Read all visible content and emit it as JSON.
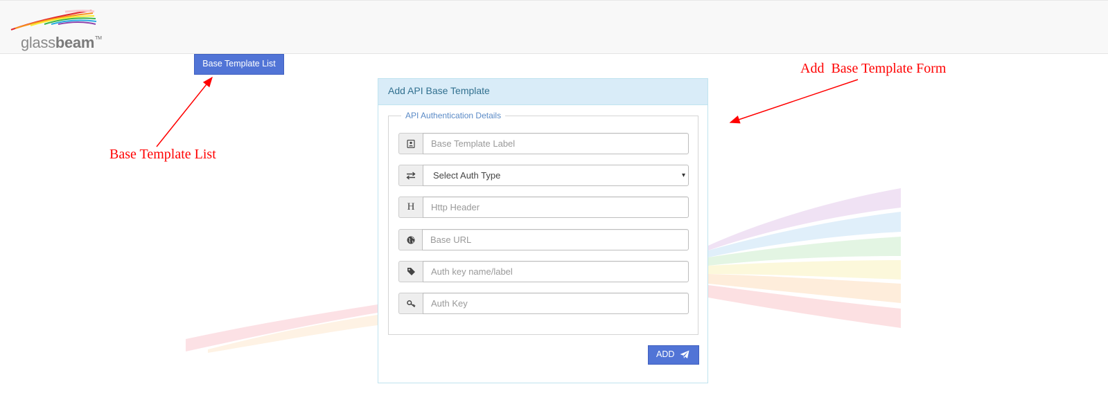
{
  "brand": {
    "logo_regular": "glass",
    "logo_bold": "beam",
    "logo_tm": "TM"
  },
  "nav": {
    "base_template_list_button": "Base Template List"
  },
  "annotations": {
    "list_note": "Base Template List",
    "form_note": "Add  Base Template Form"
  },
  "panel": {
    "title": "Add API Base Template",
    "fieldset_legend": "API Authentication Details",
    "fields": {
      "label_placeholder": "Base Template Label",
      "auth_type_selected": "Select Auth Type",
      "http_header_placeholder": "Http Header",
      "base_url_placeholder": "Base URL",
      "auth_key_name_placeholder": "Auth key name/label",
      "auth_key_placeholder": "Auth Key"
    },
    "icons": {
      "label": "address-card-icon",
      "auth_type": "exchange-arrows-icon",
      "http_header": "header-h-icon",
      "base_url": "globe-icon",
      "auth_key_name": "tag-icon",
      "auth_key": "key-icon",
      "submit": "paper-plane-icon"
    },
    "add_button": "ADD"
  },
  "colors": {
    "primary": "#5174d6",
    "panel_head_bg": "#d9ecf8",
    "panel_head_text": "#31708f",
    "annotation": "#ff0000"
  }
}
